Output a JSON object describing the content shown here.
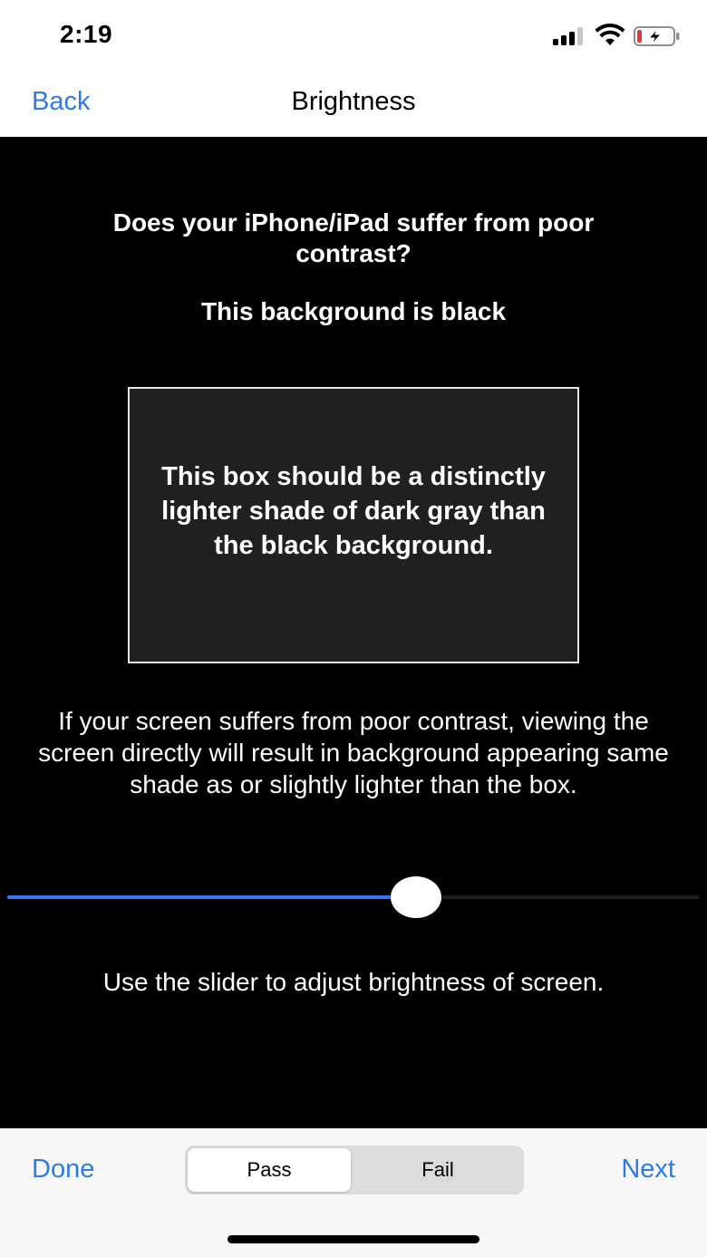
{
  "status_bar": {
    "time": "2:19",
    "icons": [
      "signal-icon",
      "wifi-icon",
      "battery-charging-icon"
    ],
    "battery_color": "#e23b3b"
  },
  "nav": {
    "back_label": "Back",
    "title": "Brightness"
  },
  "main": {
    "question": "Does your iPhone/iPad suffer from poor contrast?",
    "background_label": "This background is black",
    "box_text": "This box should be a distinctly lighter shade of dark gray than the black background.",
    "explanation": "If your screen suffers from poor contrast, viewing the screen directly will result in background appearing same shade as or slightly lighter than the box.",
    "slider": {
      "value": 0.59,
      "accent": "#3478f6"
    },
    "slider_hint": "Use the slider to adjust brightness of screen."
  },
  "toolbar": {
    "done_label": "Done",
    "next_label": "Next",
    "segments": [
      {
        "label": "Pass",
        "selected": true
      },
      {
        "label": "Fail",
        "selected": false
      }
    ],
    "accent": "#2f7ae5"
  }
}
